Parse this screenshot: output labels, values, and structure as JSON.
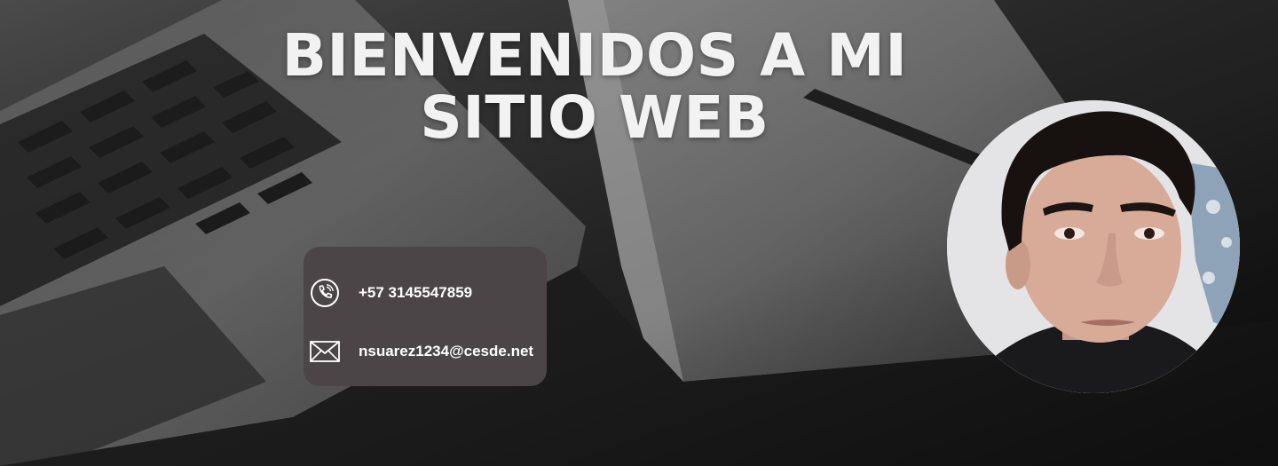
{
  "hero": {
    "title_line1": "BIENVENIDOS A MI",
    "title_line2": "SITIO WEB"
  },
  "contact": {
    "phone": "+57 3145547859",
    "phone_icon": "phone-icon",
    "email": "nsuarez1234@cesde.net",
    "email_icon": "envelope-icon"
  },
  "profile": {
    "photo": "profile-photo"
  },
  "colors": {
    "card_background": "#4b4547",
    "title_text": "#f2f2f2",
    "contact_text": "#ffffff"
  }
}
